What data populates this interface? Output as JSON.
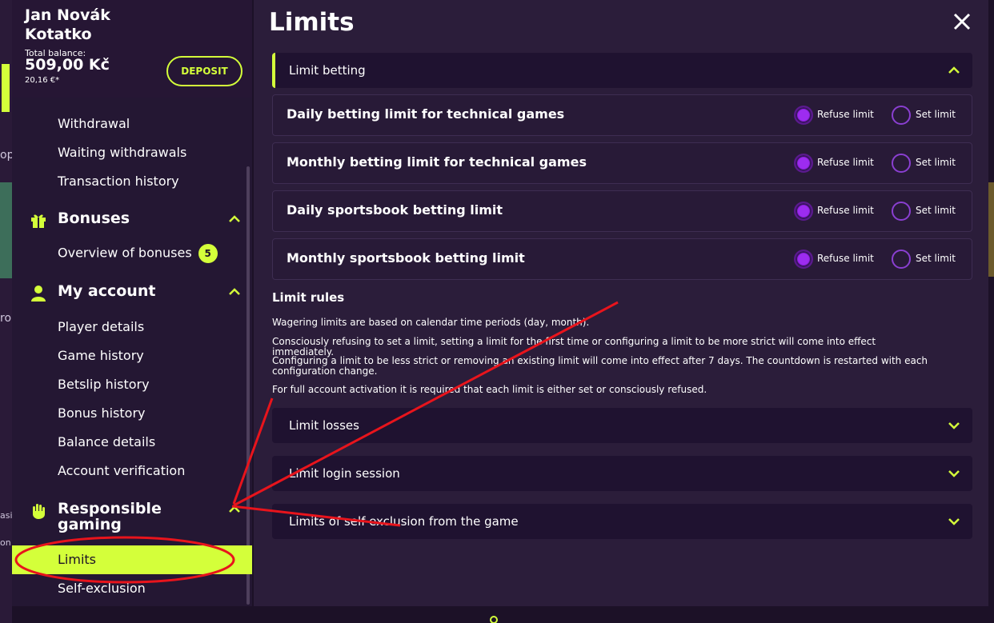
{
  "user": {
    "name": "Jan Novák Kotatko",
    "balance_label": "Total balance:",
    "balance_amount": "509,00 Kč",
    "balance_eur": "20,16 €*"
  },
  "header": {
    "deposit_label": "DEPOSIT"
  },
  "sidebar": {
    "wallet_items": [
      "Withdrawal",
      "Waiting withdrawals",
      "Transaction history"
    ],
    "bonuses": {
      "title": "Bonuses",
      "items": [
        {
          "label": "Overview of bonuses",
          "badge": "5"
        }
      ]
    },
    "account": {
      "title": "My account",
      "items": [
        "Player details",
        "Game history",
        "Betslip history",
        "Bonus history",
        "Balance details",
        "Account verification"
      ]
    },
    "responsible": {
      "title": "Responsible gaming",
      "items": [
        "Limits",
        "Self-exclusion"
      ]
    }
  },
  "main": {
    "title": "Limits",
    "betting_section": "Limit betting",
    "limits": [
      {
        "name": "Daily betting limit for technical games",
        "refuse": "Refuse limit",
        "set": "Set limit",
        "selected": "refuse"
      },
      {
        "name": "Monthly betting limit for technical games",
        "refuse": "Refuse limit",
        "set": "Set limit",
        "selected": "refuse"
      },
      {
        "name": "Daily sportsbook betting limit",
        "refuse": "Refuse limit",
        "set": "Set limit",
        "selected": "refuse"
      },
      {
        "name": "Monthly sportsbook betting limit",
        "refuse": "Refuse limit",
        "set": "Set limit",
        "selected": "refuse"
      }
    ],
    "rules_title": "Limit rules",
    "rules": [
      "Wagering limits are based on calendar time periods (day, month).",
      "Consciously refusing to set a limit, setting a limit for the first time or configuring a limit to be more strict will come into effect immediately.",
      "Configuring a limit to be less strict or removing an existing limit will come into effect after 7 days. The countdown is restarted with each configuration change.",
      "For full account activation it is required that each limit is either set or consciously refused."
    ],
    "sections": [
      "Limit losses",
      "Limit login session",
      "Limits of self-exclusion from the game"
    ]
  },
  "background": {
    "frag1": "op",
    "frag2": "ro",
    "frag3": "asi",
    "frag4": "on"
  },
  "colors": {
    "accent": "#d4ff3a",
    "radio": "#9d2cf0",
    "annotation": "#e8141c"
  }
}
